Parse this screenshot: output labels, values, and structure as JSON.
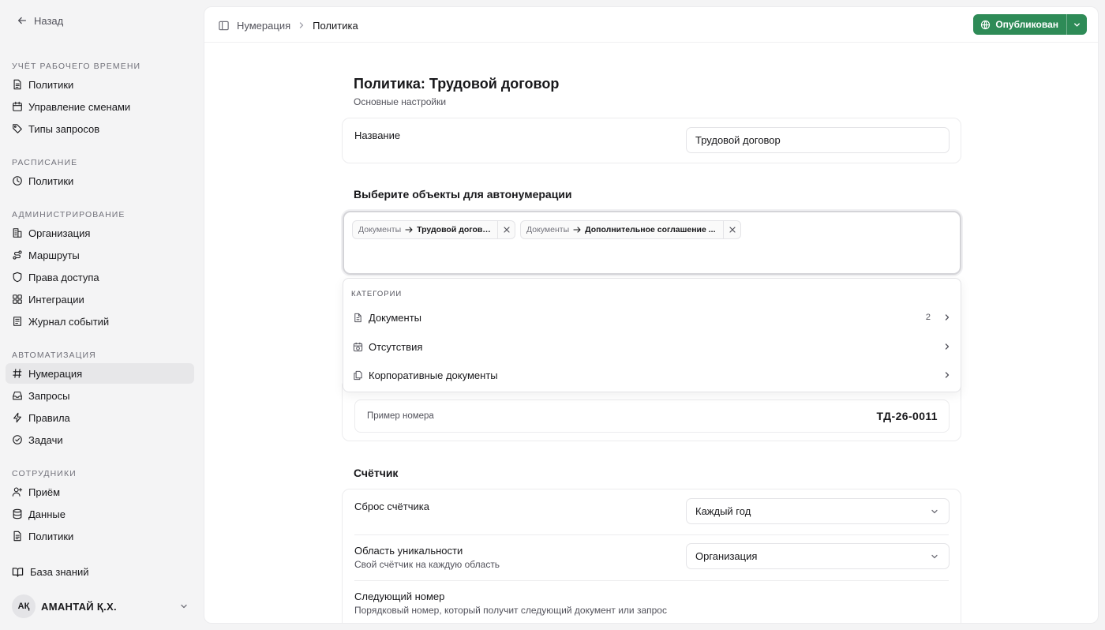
{
  "back_label": "Назад",
  "sidebar": {
    "sections": [
      {
        "heading": "Учёт рабочего времени",
        "items": [
          {
            "label": "Политики",
            "icon": "file-list-icon"
          },
          {
            "label": "Управление сменами",
            "icon": "calendar-icon"
          },
          {
            "label": "Типы запросов",
            "icon": "tag-icon"
          }
        ]
      },
      {
        "heading": "Расписание",
        "items": [
          {
            "label": "Политики",
            "icon": "clock-icon"
          }
        ]
      },
      {
        "heading": "Администрирование",
        "items": [
          {
            "label": "Организация",
            "icon": "building-icon"
          },
          {
            "label": "Маршруты",
            "icon": "route-icon"
          },
          {
            "label": "Права доступа",
            "icon": "shield-icon"
          },
          {
            "label": "Интеграции",
            "icon": "puzzle-icon"
          },
          {
            "label": "Журнал событий",
            "icon": "log-icon"
          }
        ]
      },
      {
        "heading": "Автоматизация",
        "items": [
          {
            "label": "Нумерация",
            "icon": "hash-icon",
            "active": true
          },
          {
            "label": "Запросы",
            "icon": "inbox-icon"
          },
          {
            "label": "Правила",
            "icon": "bolt-icon"
          },
          {
            "label": "Задачи",
            "icon": "check-circle-icon"
          }
        ]
      },
      {
        "heading": "Сотрудники",
        "items": [
          {
            "label": "Приём",
            "icon": "user-plus-icon"
          },
          {
            "label": "Данные",
            "icon": "database-icon"
          },
          {
            "label": "Политики",
            "icon": "file-list-icon"
          }
        ]
      }
    ],
    "knowledge_base": "База знаний",
    "user": {
      "initials": "AҚ",
      "name": "АМАНТАЙ Қ.Х."
    }
  },
  "topbar": {
    "breadcrumb": [
      "Нумерация",
      "Политика"
    ],
    "publish_label": "Опубликован"
  },
  "page": {
    "title": "Политика: Трудовой договор",
    "subtitle": "Основные настройки",
    "name_label": "Название",
    "name_value": "Трудовой договор",
    "objects_heading": "Выберите объекты для автонумерации",
    "chips": [
      {
        "category": "Документы",
        "item": "Трудовой договор"
      },
      {
        "category": "Документы",
        "item": "Дополнительное соглашение ..."
      }
    ],
    "dropdown": {
      "heading": "Категории",
      "items": [
        {
          "label": "Документы",
          "count": "2",
          "icon": "document-icon"
        },
        {
          "label": "Отсутствия",
          "count": "",
          "icon": "calendar-clock-icon"
        },
        {
          "label": "Корпоративные документы",
          "count": "",
          "icon": "documents-stack-icon"
        }
      ]
    },
    "sample_label": "Пример номера",
    "sample_value": "ТД-26-0011",
    "counter_heading": "Счётчик",
    "reset_label": "Сброс счётчика",
    "reset_value": "Каждый год",
    "scope_label": "Область уникальности",
    "scope_hint": "Свой счётчик на каждую область",
    "scope_value": "Организация",
    "next_label": "Следующий номер",
    "next_hint": "Порядковый номер, который получит следующий документ или запрос"
  },
  "colors": {
    "accent": "#2e8b57",
    "sidebar_bg": "#f4f4f5",
    "active_item": "#e7e7e9"
  }
}
